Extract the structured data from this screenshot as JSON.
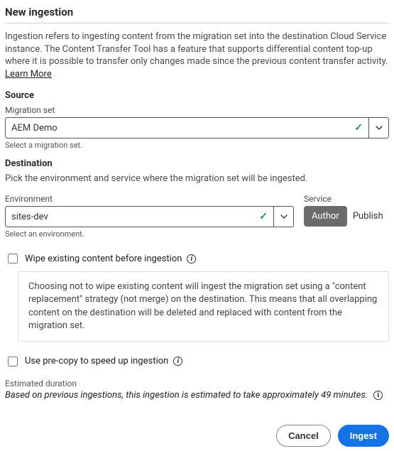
{
  "title": "New ingestion",
  "intro_text": "Ingestion refers to ingesting content from the migration set into the destination Cloud Service instance. The Content Transfer Tool has a feature that supports differential content top-up where it is possible to transfer only changes made since the previous content transfer activity. ",
  "learn_more": "Learn More",
  "source": {
    "section": "Source",
    "field_label": "Migration set",
    "value": "AEM Demo",
    "helper": "Select a migration set."
  },
  "destination": {
    "section": "Destination",
    "description": "Pick the environment and service where the migration set will be ingested.",
    "env_label": "Environment",
    "env_value": "sites-dev",
    "env_helper": "Select an environment.",
    "svc_label": "Service",
    "svc_author": "Author",
    "svc_publish": "Publish"
  },
  "wipe": {
    "label": "Wipe existing content before ingestion",
    "note": "Choosing not to wipe existing content will ingest the migration set using a \"content replacement\" strategy (not merge) on the destination. This means that all overlapping content on the destination will be deleted and replaced with content from the migration set."
  },
  "precopy": {
    "label": "Use pre-copy to speed up ingestion"
  },
  "estimate": {
    "label": "Estimated duration",
    "text": "Based on previous ingestions, this ingestion is estimated to take approximately 49 minutes."
  },
  "buttons": {
    "cancel": "Cancel",
    "ingest": "Ingest"
  }
}
